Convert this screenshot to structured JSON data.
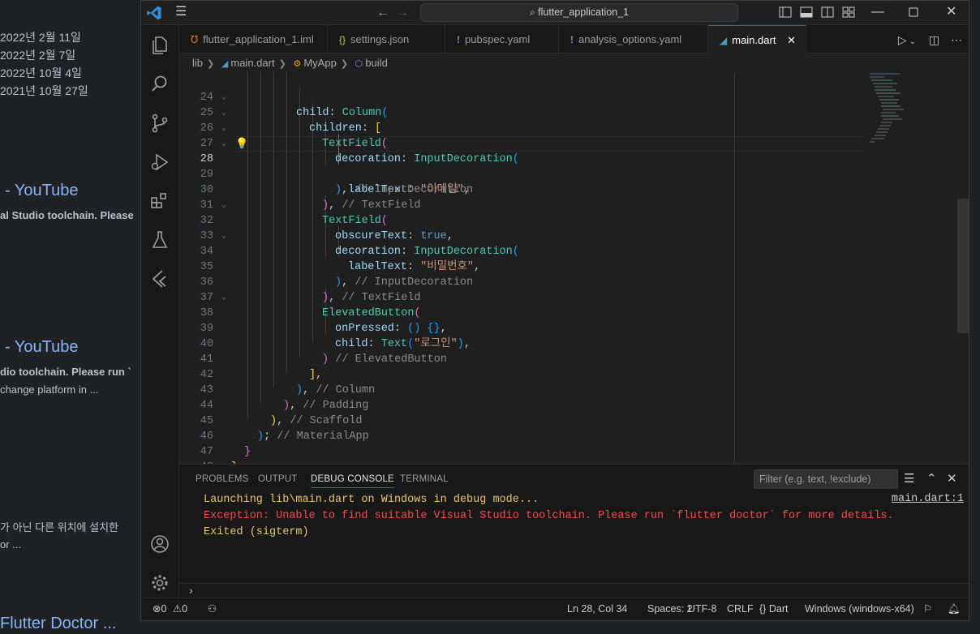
{
  "background_page": {
    "dates": [
      "2022년 2월 11일",
      "2022년 2월 7일",
      "2022년 10월 4일",
      "2021년 10월 27일"
    ],
    "results": [
      {
        "link": "- YouTube",
        "snippet_lines": [
          "al Studio toolchain. Please"
        ]
      },
      {
        "link": "- YouTube",
        "snippet_lines": [
          "dio toolchain. Please run `",
          "change platform in ..."
        ]
      }
    ],
    "korean_snippet": [
      "가 아닌 다른 위치에 설치한",
      "or ..."
    ],
    "bottom_link": "Flutter Doctor ..."
  },
  "titlebar": {
    "search": "flutter_application_1",
    "nav_back": "←",
    "nav_forward": "→"
  },
  "tabs": [
    {
      "label": "flutter_application_1.iml",
      "icon": "rss-icon",
      "icon_glyph": "℧",
      "icon_color": "#e37933"
    },
    {
      "label": "settings.json",
      "icon": "json-icon",
      "icon_glyph": "{}",
      "icon_color": "#cbcb41"
    },
    {
      "label": "pubspec.yaml",
      "icon": "yaml-icon",
      "icon_glyph": "!",
      "icon_color": "#a074c4"
    },
    {
      "label": "analysis_options.yaml",
      "icon": "yaml-icon",
      "icon_glyph": "!",
      "icon_color": "#a074c4"
    },
    {
      "label": "main.dart",
      "icon": "dart-icon",
      "icon_glyph": "◢",
      "icon_color": "#519aba",
      "active": true,
      "close": "✕"
    }
  ],
  "breadcrumbs": [
    "lib",
    "main.dart",
    "MyApp",
    "build"
  ],
  "editor": {
    "current_line": 28,
    "lines": [
      {
        "n": "24",
        "fold": true
      },
      {
        "n": "25",
        "fold": true
      },
      {
        "n": "26",
        "fold": true
      },
      {
        "n": "27",
        "fold": true
      },
      {
        "n": "28",
        "fold": false
      },
      {
        "n": "29",
        "fold": false
      },
      {
        "n": "30",
        "fold": false
      },
      {
        "n": "31",
        "fold": true
      },
      {
        "n": "32",
        "fold": false
      },
      {
        "n": "33",
        "fold": true
      },
      {
        "n": "34",
        "fold": false
      },
      {
        "n": "35",
        "fold": false
      },
      {
        "n": "36",
        "fold": false
      },
      {
        "n": "37",
        "fold": true
      },
      {
        "n": "38",
        "fold": false
      },
      {
        "n": "39",
        "fold": false
      },
      {
        "n": "40",
        "fold": false
      },
      {
        "n": "41",
        "fold": false
      },
      {
        "n": "42",
        "fold": false
      },
      {
        "n": "43",
        "fold": false
      },
      {
        "n": "44",
        "fold": false
      },
      {
        "n": "45",
        "fold": false
      },
      {
        "n": "46",
        "fold": false
      },
      {
        "n": "47",
        "fold": false
      },
      {
        "n": "48",
        "fold": false
      }
    ],
    "code": {
      "l24_a": "child",
      "l24_b": "Column",
      "l25_a": "children",
      "l26_a": "TextField",
      "l27_a": "decoration",
      "l27_b": "InputDecoration",
      "l28_a": "labelText",
      "l28_b": "\"이메일\"",
      "l29_c": "// InputDecoration",
      "l30_c": "// TextField",
      "l31_a": "TextField",
      "l32_a": "obscureText",
      "l32_b": "true",
      "l33_a": "decoration",
      "l33_b": "InputDecoration",
      "l34_a": "labelText",
      "l34_b": "\"비밀번호\"",
      "l35_c": "// InputDecoration",
      "l36_c": "// TextField",
      "l37_a": "ElevatedButton",
      "l38_a": "onPressed",
      "l39_a": "child",
      "l39_b": "Text",
      "l39_c": "\"로그인\"",
      "l40_c": "// ElevatedButton",
      "l42_c": "// Column",
      "l43_c": "// Padding",
      "l44_c": "// Scaffold",
      "l45_c": "// MaterialApp"
    }
  },
  "panel": {
    "tabs": [
      "PROBLEMS",
      "OUTPUT",
      "DEBUG CONSOLE",
      "TERMINAL"
    ],
    "active_tab": "DEBUG CONSOLE",
    "filter_placeholder": "Filter (e.g. text, !exclude)",
    "output": [
      {
        "text": "Launching lib\\main.dart on Windows in debug mode...",
        "color": "#e9c46a"
      },
      {
        "text": "Exception: Unable to find suitable Visual Studio toolchain. Please run `flutter doctor` for more details.",
        "color": "#f14c4c"
      },
      {
        "text": "Exited (sigterm)",
        "color": "#e9c46a"
      }
    ],
    "source_link": "main.dart:1",
    "prompt": "›"
  },
  "statusbar": {
    "errors": "0",
    "warnings": "0",
    "position": "Ln 28, Col 34",
    "spaces": "Spaces: 2",
    "encoding": "UTF-8",
    "eol": "CRLF",
    "language": "Dart",
    "platform": "Windows (windows-x64)"
  },
  "colors": {
    "accent": "#0078d4",
    "editor_bg": "#1f1f1f",
    "error": "#f14c4c"
  }
}
